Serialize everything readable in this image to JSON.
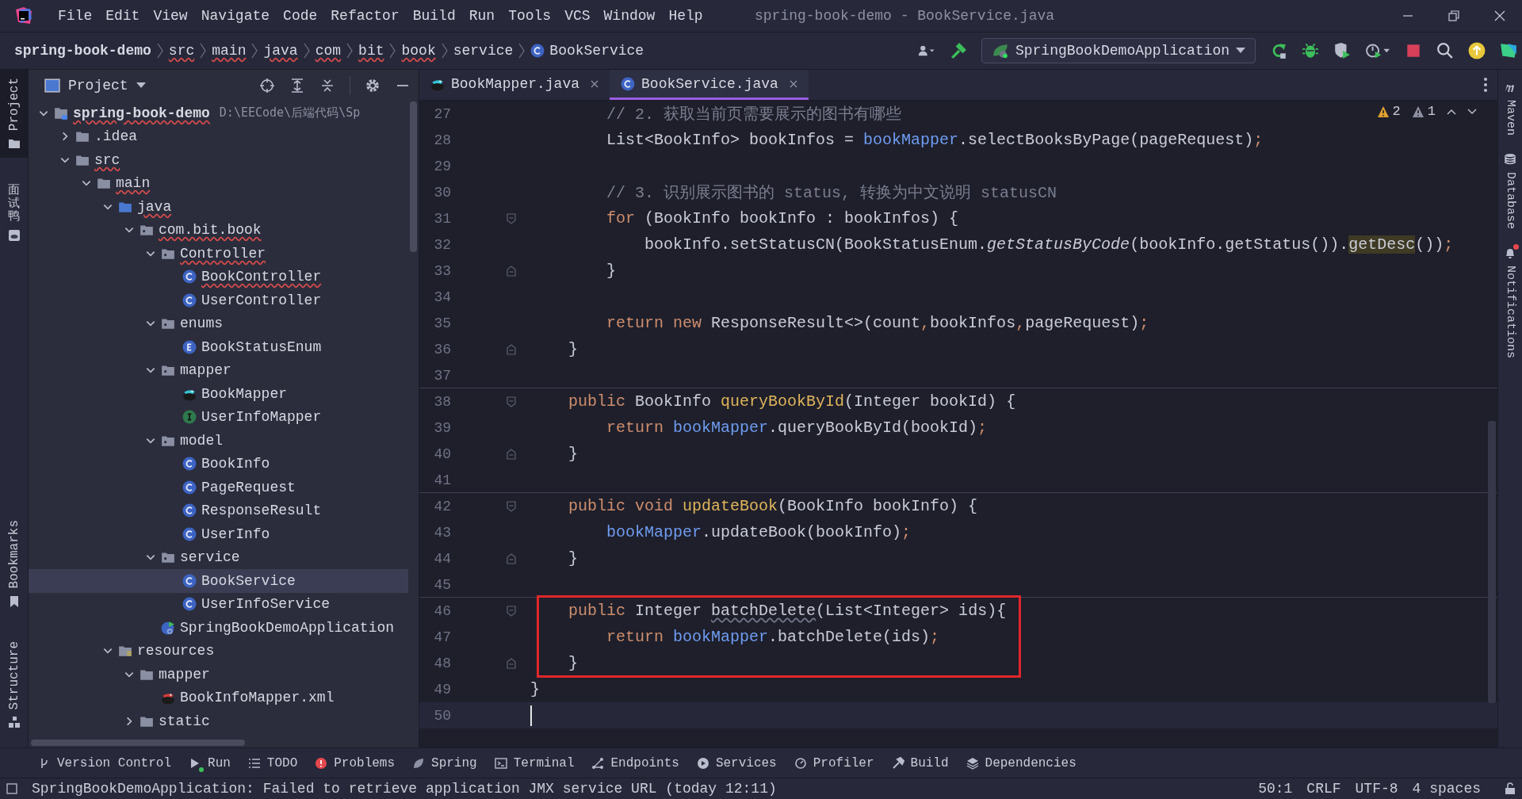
{
  "window": {
    "title": "spring-book-demo - BookService.java"
  },
  "menu": [
    "File",
    "Edit",
    "View",
    "Navigate",
    "Code",
    "Refactor",
    "Build",
    "Run",
    "Tools",
    "VCS",
    "Window",
    "Help"
  ],
  "breadcrumbs": [
    {
      "label": "spring-book-demo",
      "kind": "project",
      "underlined": false
    },
    {
      "label": "src",
      "kind": "folder",
      "underlined": true
    },
    {
      "label": "main",
      "kind": "folder",
      "underlined": true
    },
    {
      "label": "java",
      "kind": "folder",
      "underlined": true
    },
    {
      "label": "com",
      "kind": "folder",
      "underlined": true
    },
    {
      "label": "bit",
      "kind": "folder",
      "underlined": true
    },
    {
      "label": "book",
      "kind": "folder",
      "underlined": true
    },
    {
      "label": "service",
      "kind": "folder",
      "underlined": false
    },
    {
      "label": "BookService",
      "kind": "class",
      "underlined": false
    }
  ],
  "run_configuration": "SpringBookDemoApplication",
  "left_tools": [
    {
      "label": "Project",
      "kind": "project",
      "selected": true
    },
    {
      "label": "面试鸭",
      "kind": "plugin",
      "selected": false
    },
    {
      "label": "Bookmarks",
      "kind": "bookmarks",
      "selected": false
    },
    {
      "label": "Structure",
      "kind": "structure",
      "selected": false
    }
  ],
  "project": {
    "title": "Project",
    "tree": [
      {
        "label": "spring-book-demo",
        "path": "D:\\EECode\\后端代码\\Sp",
        "kind": "module",
        "expanded": true,
        "underlined": true,
        "selected": false,
        "children": [
          {
            "label": ".idea",
            "kind": "folder",
            "expanded": false,
            "underlined": false,
            "selected": false
          },
          {
            "label": "src",
            "kind": "folder",
            "expanded": true,
            "underlined": true,
            "selected": false,
            "children": [
              {
                "label": "main",
                "kind": "folder",
                "expanded": true,
                "underlined": true,
                "selected": false,
                "children": [
                  {
                    "label": "java",
                    "kind": "source",
                    "expanded": true,
                    "underlined": true,
                    "selected": false,
                    "children": [
                      {
                        "label": "com.bit.book",
                        "kind": "package",
                        "expanded": true,
                        "underlined": true,
                        "selected": false,
                        "children": [
                          {
                            "label": "Controller",
                            "kind": "package",
                            "expanded": true,
                            "underlined": true,
                            "selected": false,
                            "children": [
                              {
                                "label": "BookController",
                                "kind": "class",
                                "underlined": true,
                                "selected": false
                              },
                              {
                                "label": "UserController",
                                "kind": "class",
                                "underlined": false,
                                "selected": false
                              }
                            ]
                          },
                          {
                            "label": "enums",
                            "kind": "package",
                            "expanded": true,
                            "underlined": false,
                            "selected": false,
                            "children": [
                              {
                                "label": "BookStatusEnum",
                                "kind": "enum",
                                "underlined": false,
                                "selected": false
                              }
                            ]
                          },
                          {
                            "label": "mapper",
                            "kind": "package",
                            "expanded": true,
                            "underlined": false,
                            "selected": false,
                            "children": [
                              {
                                "label": "BookMapper",
                                "kind": "mapper",
                                "underlined": false,
                                "selected": false
                              },
                              {
                                "label": "UserInfoMapper",
                                "kind": "interface",
                                "underlined": false,
                                "selected": false
                              }
                            ]
                          },
                          {
                            "label": "model",
                            "kind": "package",
                            "expanded": true,
                            "underlined": false,
                            "selected": false,
                            "children": [
                              {
                                "label": "BookInfo",
                                "kind": "class",
                                "underlined": false,
                                "selected": false
                              },
                              {
                                "label": "PageRequest",
                                "kind": "class",
                                "underlined": false,
                                "selected": false
                              },
                              {
                                "label": "ResponseResult",
                                "kind": "class",
                                "underlined": false,
                                "selected": false
                              },
                              {
                                "label": "UserInfo",
                                "kind": "class",
                                "underlined": false,
                                "selected": false
                              }
                            ]
                          },
                          {
                            "label": "service",
                            "kind": "package",
                            "expanded": true,
                            "underlined": false,
                            "selected": false,
                            "children": [
                              {
                                "label": "BookService",
                                "kind": "class",
                                "underlined": false,
                                "selected": true
                              },
                              {
                                "label": "UserInfoService",
                                "kind": "class",
                                "underlined": false,
                                "selected": false
                              }
                            ]
                          },
                          {
                            "label": "SpringBookDemoApplication",
                            "kind": "app",
                            "underlined": false,
                            "selected": false
                          }
                        ]
                      }
                    ]
                  },
                  {
                    "label": "resources",
                    "kind": "resources",
                    "expanded": true,
                    "underlined": false,
                    "selected": false,
                    "children": [
                      {
                        "label": "mapper",
                        "kind": "folder",
                        "expanded": true,
                        "underlined": false,
                        "selected": false,
                        "children": [
                          {
                            "label": "BookInfoMapper.xml",
                            "kind": "xml",
                            "underlined": false,
                            "selected": false
                          }
                        ]
                      },
                      {
                        "label": "static",
                        "kind": "folder",
                        "expanded": false,
                        "underlined": false,
                        "selected": false
                      }
                    ]
                  }
                ]
              }
            ]
          }
        ]
      }
    ]
  },
  "tabs": [
    {
      "label": "BookMapper.java",
      "kind": "mapper",
      "selected": false
    },
    {
      "label": "BookService.java",
      "kind": "class",
      "selected": true
    }
  ],
  "editor": {
    "warnings": "2",
    "weak_warnings": "1",
    "lines": [
      {
        "number": "27",
        "segments": [
          {
            "kind": "comment",
            "text": "        // 2. 获取当前页需要展示的图书有哪些"
          }
        ]
      },
      {
        "number": "28",
        "segments": [
          {
            "kind": "plain",
            "text": "        List<BookInfo> bookInfos = "
          },
          {
            "kind": "field",
            "text": "bookMapper"
          },
          {
            "kind": "plain",
            "text": ".selectBooksByPage(pageRequest)"
          },
          {
            "kind": "punct",
            "text": ";"
          }
        ]
      },
      {
        "number": "29"
      },
      {
        "number": "30",
        "segments": [
          {
            "kind": "comment",
            "text": "        // 3. 识别展示图书的 status, 转换为中文说明 statusCN"
          }
        ]
      },
      {
        "number": "31",
        "fold_start": true,
        "segments": [
          {
            "kind": "keyword",
            "text": "        for"
          },
          {
            "kind": "plain",
            "text": " (BookInfo bookInfo : bookInfos) {"
          }
        ]
      },
      {
        "number": "32",
        "segments": [
          {
            "kind": "plain",
            "text": "            bookInfo.setStatusCN(BookStatusEnum."
          },
          {
            "kind": "static",
            "text": "getStatusByCode"
          },
          {
            "kind": "plain",
            "text": "(bookInfo.getStatus())."
          },
          {
            "kind": "usage",
            "text": "getDesc"
          },
          {
            "kind": "plain",
            "text": "())"
          },
          {
            "kind": "punct",
            "text": ";"
          }
        ]
      },
      {
        "number": "33",
        "fold_end": true,
        "segments": [
          {
            "kind": "plain",
            "text": "        }"
          }
        ]
      },
      {
        "number": "34"
      },
      {
        "number": "35",
        "segments": [
          {
            "kind": "keyword",
            "text": "        return new"
          },
          {
            "kind": "plain",
            "text": " ResponseResult<>(count"
          },
          {
            "kind": "punct",
            "text": ","
          },
          {
            "kind": "plain",
            "text": "bookInfos"
          },
          {
            "kind": "punct",
            "text": ","
          },
          {
            "kind": "plain",
            "text": "pageRequest)"
          },
          {
            "kind": "punct",
            "text": ";"
          }
        ]
      },
      {
        "number": "36",
        "fold_end": true,
        "segments": [
          {
            "kind": "plain",
            "text": "    }"
          }
        ]
      },
      {
        "number": "37"
      },
      {
        "number": "38",
        "fold_start": true,
        "separator": true,
        "segments": [
          {
            "kind": "keyword",
            "text": "    public"
          },
          {
            "kind": "plain",
            "text": " BookInfo "
          },
          {
            "kind": "declaration",
            "text": "queryBookById"
          },
          {
            "kind": "plain",
            "text": "(Integer bookId) {"
          }
        ]
      },
      {
        "number": "39",
        "segments": [
          {
            "kind": "keyword",
            "text": "        return "
          },
          {
            "kind": "field",
            "text": "bookMapper"
          },
          {
            "kind": "plain",
            "text": ".queryBookById(bookId)"
          },
          {
            "kind": "punct",
            "text": ";"
          }
        ]
      },
      {
        "number": "40",
        "fold_end": true,
        "segments": [
          {
            "kind": "plain",
            "text": "    }"
          }
        ]
      },
      {
        "number": "41"
      },
      {
        "number": "42",
        "fold_start": true,
        "separator": true,
        "segments": [
          {
            "kind": "keyword",
            "text": "    public void "
          },
          {
            "kind": "declaration",
            "text": "updateBook"
          },
          {
            "kind": "plain",
            "text": "(BookInfo bookInfo) {"
          }
        ]
      },
      {
        "number": "43",
        "segments": [
          {
            "kind": "field",
            "text": "        bookMapper"
          },
          {
            "kind": "plain",
            "text": ".updateBook(bookInfo)"
          },
          {
            "kind": "punct",
            "text": ";"
          }
        ]
      },
      {
        "number": "44",
        "fold_end": true,
        "segments": [
          {
            "kind": "plain",
            "text": "    }"
          }
        ]
      },
      {
        "number": "45"
      },
      {
        "number": "46",
        "fold_start": true,
        "separator": true,
        "framed": true,
        "segments": [
          {
            "kind": "keyword",
            "text": "    public"
          },
          {
            "kind": "plain",
            "text": " Integer "
          },
          {
            "kind": "unused",
            "text": "batchDelete"
          },
          {
            "kind": "plain",
            "text": "(List<Integer> ids){"
          }
        ]
      },
      {
        "number": "47",
        "framed": true,
        "segments": [
          {
            "kind": "keyword",
            "text": "        return "
          },
          {
            "kind": "field",
            "text": "bookMapper"
          },
          {
            "kind": "plain",
            "text": ".batchDelete(ids)"
          },
          {
            "kind": "punct",
            "text": ";"
          }
        ]
      },
      {
        "number": "48",
        "fold_end": true,
        "framed": true,
        "segments": [
          {
            "kind": "plain",
            "text": "    }"
          }
        ]
      },
      {
        "number": "49",
        "segments": [
          {
            "kind": "plain",
            "text": "}"
          }
        ]
      },
      {
        "number": "50",
        "current": true
      }
    ]
  },
  "right_tools": [
    {
      "label": "Maven",
      "kind": "maven",
      "alert": false
    },
    {
      "label": "Database",
      "kind": "database",
      "alert": false
    },
    {
      "label": "Notifications",
      "kind": "notifications",
      "alert": true
    }
  ],
  "tool_windows": [
    {
      "label": "Version Control",
      "kind": "vcs",
      "running": false
    },
    {
      "label": "Run",
      "kind": "run",
      "running": true
    },
    {
      "label": "TODO",
      "kind": "todo",
      "running": false
    },
    {
      "label": "Problems",
      "kind": "problems",
      "running": false
    },
    {
      "label": "Spring",
      "kind": "spring",
      "running": false
    },
    {
      "label": "Terminal",
      "kind": "terminal",
      "running": false
    },
    {
      "label": "Endpoints",
      "kind": "endpoints",
      "running": false
    },
    {
      "label": "Services",
      "kind": "services",
      "running": false
    },
    {
      "label": "Profiler",
      "kind": "profiler",
      "running": false
    },
    {
      "label": "Build",
      "kind": "build",
      "running": false
    },
    {
      "label": "Dependencies",
      "kind": "dependencies",
      "running": false
    }
  ],
  "status_bar": {
    "message": "SpringBookDemoApplication: Failed to retrieve application JMX service URL (today 12:11)",
    "position": "50:1",
    "line_separator": "CRLF",
    "encoding": "UTF-8",
    "indent": "4 spaces"
  }
}
